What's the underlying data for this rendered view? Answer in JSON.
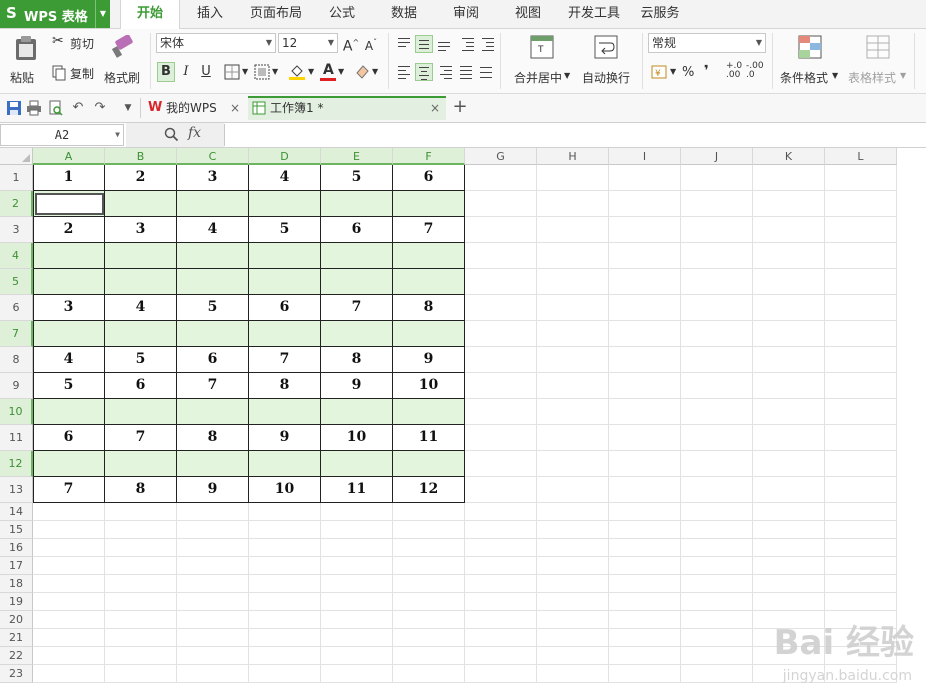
{
  "app": {
    "name": "WPS 表格",
    "logo": "S"
  },
  "menu_tabs": [
    "开始",
    "插入",
    "页面布局",
    "公式",
    "数据",
    "审阅",
    "视图",
    "开发工具",
    "云服务"
  ],
  "ribbon": {
    "paste": "粘贴",
    "cut": "剪切",
    "copy": "复制",
    "format_painter": "格式刷",
    "font_name": "宋体",
    "font_size": "12",
    "bold": "B",
    "italic": "I",
    "underline": "U",
    "merge_center": "合并居中",
    "wrap_text": "自动换行",
    "number_format": "常规",
    "percent": "%",
    "comma": "❜",
    "cond_format": "条件格式",
    "table_style": "表格样式"
  },
  "doc_tabs": [
    {
      "label": "我的WPS",
      "icon": "wps-logo-icon"
    },
    {
      "label": "工作簿1 *",
      "icon": "sheet-icon",
      "active": true
    }
  ],
  "formula_bar": {
    "name_box": "A2",
    "fx": "fx",
    "formula": ""
  },
  "columns": [
    "A",
    "B",
    "C",
    "D",
    "E",
    "F",
    "G",
    "H",
    "I",
    "J",
    "K",
    "L"
  ],
  "selected_columns": [
    "A",
    "B",
    "C",
    "D",
    "E",
    "F"
  ],
  "selected_rows": [
    2,
    4,
    5,
    7,
    10,
    12
  ],
  "rows": [
    1,
    2,
    3,
    4,
    5,
    6,
    7,
    8,
    9,
    10,
    11,
    12,
    13,
    14,
    15,
    16,
    17,
    18,
    19,
    20,
    21,
    22,
    23
  ],
  "cells": {
    "1": [
      "1",
      "2",
      "3",
      "4",
      "5",
      "6"
    ],
    "2": [
      "",
      "",
      "",
      "",
      "",
      ""
    ],
    "3": [
      "2",
      "3",
      "4",
      "5",
      "6",
      "7"
    ],
    "4": [
      "",
      "",
      "",
      "",
      "",
      ""
    ],
    "5": [
      "",
      "",
      "",
      "",
      "",
      ""
    ],
    "6": [
      "3",
      "4",
      "5",
      "6",
      "7",
      "8"
    ],
    "7": [
      "",
      "",
      "",
      "",
      "",
      ""
    ],
    "8": [
      "4",
      "5",
      "6",
      "7",
      "8",
      "9"
    ],
    "9": [
      "5",
      "6",
      "7",
      "8",
      "9",
      "10"
    ],
    "10": [
      "",
      "",
      "",
      "",
      "",
      ""
    ],
    "11": [
      "6",
      "7",
      "8",
      "9",
      "10",
      "11"
    ],
    "12": [
      "",
      "",
      "",
      "",
      "",
      ""
    ],
    "13": [
      "7",
      "8",
      "9",
      "10",
      "11",
      "12"
    ]
  },
  "active_cell": "A2",
  "watermark": {
    "text": "Bai 经验",
    "sub": "jingyan.baidu.com"
  }
}
